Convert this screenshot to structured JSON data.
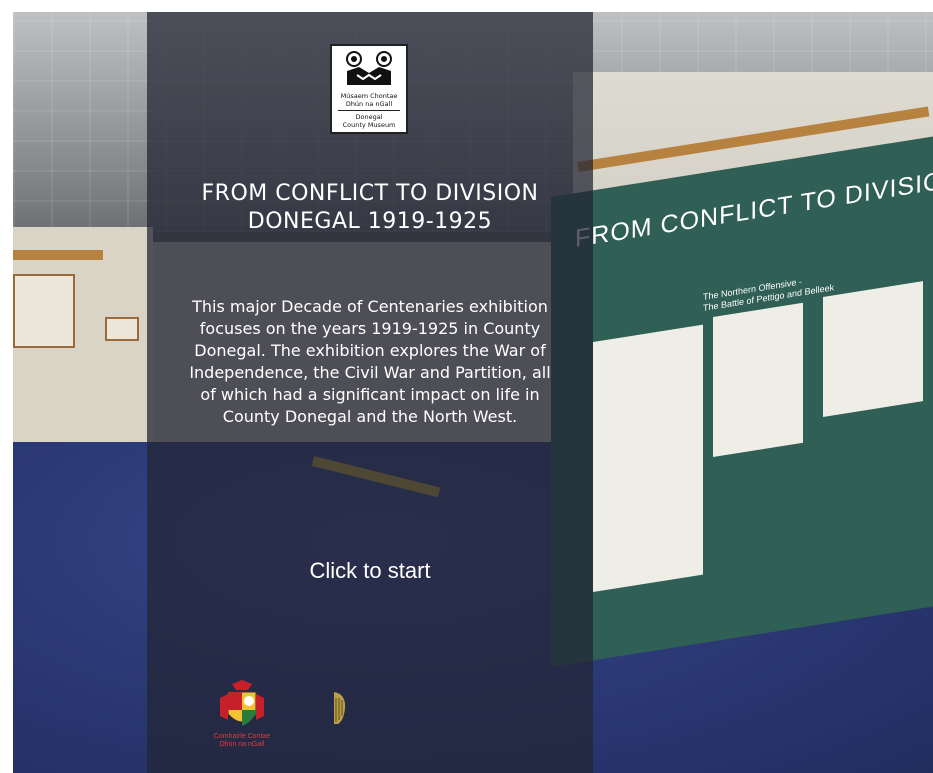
{
  "museum_logo": {
    "line1": "Músaem Chontae",
    "line2": "Dhún na nGall",
    "line3": "Donegal",
    "line4": "County Museum"
  },
  "title": {
    "line1": "FROM CONFLICT TO DIVISION",
    "line2": "DONEGAL 1919-1925"
  },
  "description": {
    "line1": "This major Decade of Centenaries exhibition",
    "line2": "focuses on the years 1919-1925 in County",
    "line3": "Donegal. The exhibition explores the War of",
    "line4": "Independence, the Civil War and Partition, all",
    "line5": "of which had a significant impact on life in",
    "line6": "County Donegal and the North West."
  },
  "start_label": "Click to start",
  "sponsors": {
    "council_line1": "Comhairle Contae",
    "council_line2": "Dhún na nGall",
    "gov_text": ""
  },
  "background_panel": {
    "heading": "FROM CONFLICT TO DIVISION - DO",
    "subheading_line1": "The Northern Offensive -",
    "subheading_line2": "The Battle of Pettigo and Belleek"
  },
  "colors": {
    "overlay": "#232634",
    "panel_green": "#2f5f55",
    "floor_blue": "#2c3a78",
    "council_red": "#e23b3b",
    "gov_green": "#1c7a4a"
  }
}
